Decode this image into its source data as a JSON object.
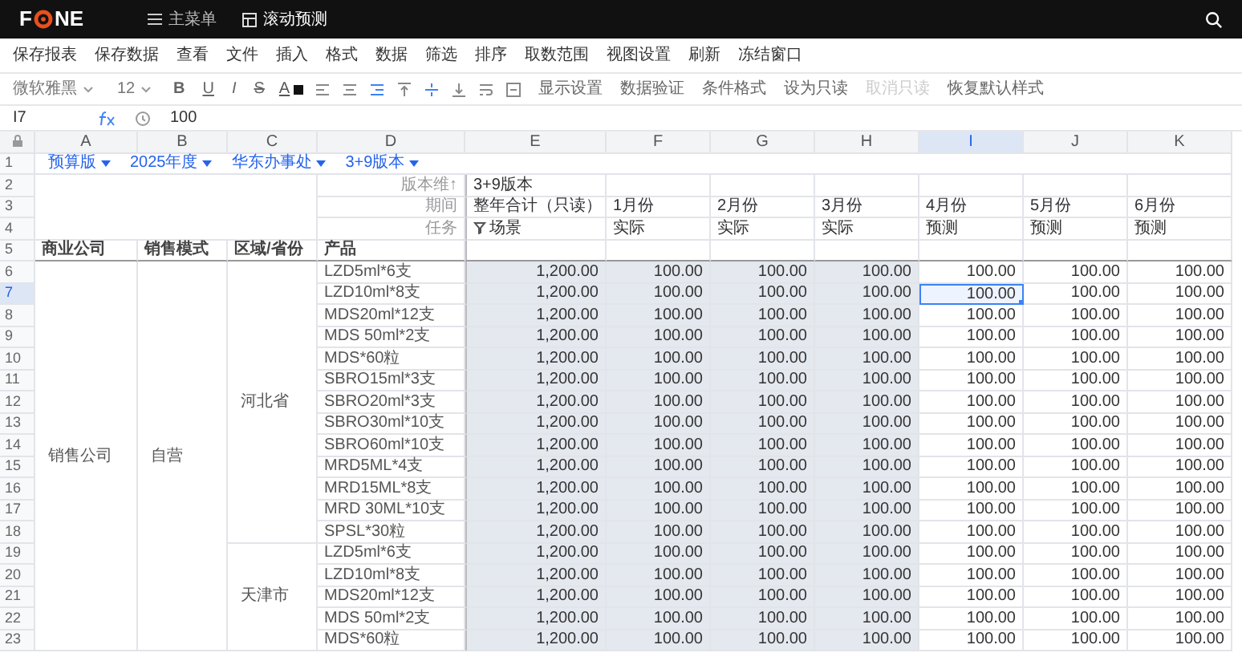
{
  "top_bar": {
    "logo_left": "F",
    "logo_right": "NE",
    "nav": [
      {
        "label": "主菜单",
        "kind": "menu",
        "selected": false
      },
      {
        "label": "滚动预测",
        "kind": "sheet",
        "selected": true
      }
    ]
  },
  "menu": [
    "保存报表",
    "保存数据",
    "查看",
    "文件",
    "插入",
    "格式",
    "数据",
    "筛选",
    "排序",
    "取数范围",
    "视图设置",
    "刷新",
    "冻结窗口"
  ],
  "toolbar": {
    "font": "微软雅黑",
    "size": "12",
    "styles": [
      "B",
      "U",
      "I",
      "S"
    ],
    "font_color_label": "A",
    "h_align": [
      {
        "kind": "left",
        "selected": false
      },
      {
        "kind": "center",
        "selected": false
      },
      {
        "kind": "right",
        "selected": true
      }
    ],
    "v_align": [
      {
        "kind": "top",
        "selected": false
      },
      {
        "kind": "middle",
        "selected": true
      },
      {
        "kind": "bottom",
        "selected": false
      }
    ],
    "actions": [
      {
        "label": "显示设置",
        "disabled": false
      },
      {
        "label": "数据验证",
        "disabled": false
      },
      {
        "label": "条件格式",
        "disabled": false
      },
      {
        "label": "设为只读",
        "disabled": false
      },
      {
        "label": "取消只读",
        "disabled": true
      },
      {
        "label": "恢复默认样式",
        "disabled": false
      }
    ]
  },
  "formula_bar": {
    "cell": "I7",
    "value": "100"
  },
  "columns": [
    {
      "label": "A",
      "selected": false
    },
    {
      "label": "B",
      "selected": false
    },
    {
      "label": "C",
      "selected": false
    },
    {
      "label": "D",
      "selected": false
    },
    {
      "label": "E",
      "selected": false,
      "readonly": true
    },
    {
      "label": "F",
      "selected": false,
      "readonly": true
    },
    {
      "label": "G",
      "selected": false,
      "readonly": true
    },
    {
      "label": "H",
      "selected": false,
      "readonly": true
    },
    {
      "label": "I",
      "selected": true,
      "readonly": false
    },
    {
      "label": "J",
      "selected": false,
      "readonly": false
    },
    {
      "label": "K",
      "selected": false,
      "readonly": false
    }
  ],
  "filter_row": {
    "num": "1",
    "filters": [
      "预算版",
      "2025年度",
      "华东办事处",
      "3+9版本"
    ]
  },
  "header_rows": [
    {
      "num": "2",
      "label": "版本维↑",
      "cells": [
        "3+9版本"
      ]
    },
    {
      "num": "3",
      "label": "期间",
      "cells": [
        "整年合计（只读）",
        "1月份",
        "2月份",
        "3月份",
        "4月份",
        "5月份",
        "6月份"
      ]
    },
    {
      "num": "4",
      "label": "任务",
      "cells": [
        "场景",
        "实际",
        "实际",
        "实际",
        "预测",
        "预测",
        "预测"
      ]
    }
  ],
  "title_row": {
    "num": "5",
    "cells": [
      "商业公司",
      "销售模式",
      "区域/省份",
      "产品"
    ]
  },
  "groups": [
    {
      "company": "销售公司",
      "mode": "自营",
      "regions": [
        {
          "name": "河北省",
          "rows": [
            {
              "num": "6",
              "product": "LZD5ml*6支",
              "values": [
                "1,200.00",
                "100.00",
                "100.00",
                "100.00",
                "100.00",
                "100.00",
                "100.00"
              ],
              "selected": false
            },
            {
              "num": "7",
              "product": "LZD10ml*8支",
              "values": [
                "1,200.00",
                "100.00",
                "100.00",
                "100.00",
                "100.00",
                "100.00",
                "100.00"
              ],
              "selected": true
            },
            {
              "num": "8",
              "product": "MDS20ml*12支",
              "values": [
                "1,200.00",
                "100.00",
                "100.00",
                "100.00",
                "100.00",
                "100.00",
                "100.00"
              ],
              "selected": false
            },
            {
              "num": "9",
              "product": "MDS 50ml*2支",
              "values": [
                "1,200.00",
                "100.00",
                "100.00",
                "100.00",
                "100.00",
                "100.00",
                "100.00"
              ],
              "selected": false
            },
            {
              "num": "10",
              "product": "MDS*60粒",
              "values": [
                "1,200.00",
                "100.00",
                "100.00",
                "100.00",
                "100.00",
                "100.00",
                "100.00"
              ],
              "selected": false
            },
            {
              "num": "11",
              "product": "SBRO15ml*3支",
              "values": [
                "1,200.00",
                "100.00",
                "100.00",
                "100.00",
                "100.00",
                "100.00",
                "100.00"
              ],
              "selected": false
            },
            {
              "num": "12",
              "product": "SBRO20ml*3支",
              "values": [
                "1,200.00",
                "100.00",
                "100.00",
                "100.00",
                "100.00",
                "100.00",
                "100.00"
              ],
              "selected": false
            },
            {
              "num": "13",
              "product": "SBRO30ml*10支",
              "values": [
                "1,200.00",
                "100.00",
                "100.00",
                "100.00",
                "100.00",
                "100.00",
                "100.00"
              ],
              "selected": false
            },
            {
              "num": "14",
              "product": "SBRO60ml*10支",
              "values": [
                "1,200.00",
                "100.00",
                "100.00",
                "100.00",
                "100.00",
                "100.00",
                "100.00"
              ],
              "selected": false
            },
            {
              "num": "15",
              "product": "MRD5ML*4支",
              "values": [
                "1,200.00",
                "100.00",
                "100.00",
                "100.00",
                "100.00",
                "100.00",
                "100.00"
              ],
              "selected": false
            },
            {
              "num": "16",
              "product": "MRD15ML*8支",
              "values": [
                "1,200.00",
                "100.00",
                "100.00",
                "100.00",
                "100.00",
                "100.00",
                "100.00"
              ],
              "selected": false
            },
            {
              "num": "17",
              "product": "MRD 30ML*10支",
              "values": [
                "1,200.00",
                "100.00",
                "100.00",
                "100.00",
                "100.00",
                "100.00",
                "100.00"
              ],
              "selected": false
            },
            {
              "num": "18",
              "product": "SPSL*30粒",
              "values": [
                "1,200.00",
                "100.00",
                "100.00",
                "100.00",
                "100.00",
                "100.00",
                "100.00"
              ],
              "selected": false
            }
          ]
        },
        {
          "name": "天津市",
          "rows": [
            {
              "num": "19",
              "product": "LZD5ml*6支",
              "values": [
                "1,200.00",
                "100.00",
                "100.00",
                "100.00",
                "100.00",
                "100.00",
                "100.00"
              ],
              "selected": false
            },
            {
              "num": "20",
              "product": "LZD10ml*8支",
              "values": [
                "1,200.00",
                "100.00",
                "100.00",
                "100.00",
                "100.00",
                "100.00",
                "100.00"
              ],
              "selected": false
            },
            {
              "num": "21",
              "product": "MDS20ml*12支",
              "values": [
                "1,200.00",
                "100.00",
                "100.00",
                "100.00",
                "100.00",
                "100.00",
                "100.00"
              ],
              "selected": false
            },
            {
              "num": "22",
              "product": "MDS 50ml*2支",
              "values": [
                "1,200.00",
                "100.00",
                "100.00",
                "100.00",
                "100.00",
                "100.00",
                "100.00"
              ],
              "selected": false
            },
            {
              "num": "23",
              "product": "MDS*60粒",
              "values": [
                "1,200.00",
                "100.00",
                "100.00",
                "100.00",
                "100.00",
                "100.00",
                "100.00"
              ],
              "selected": false
            }
          ]
        }
      ]
    }
  ]
}
